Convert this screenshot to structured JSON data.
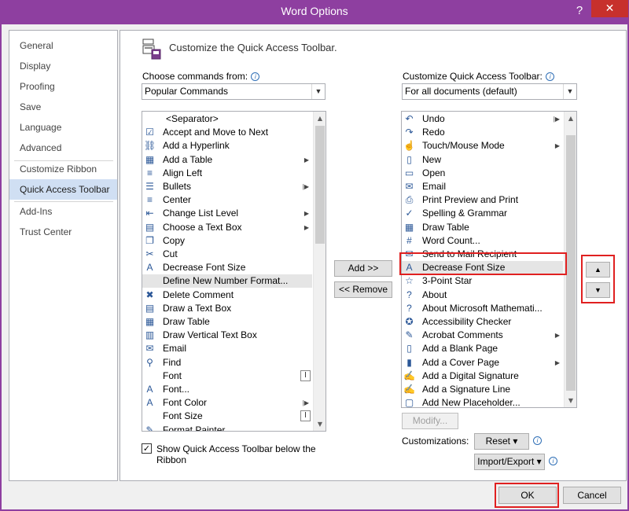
{
  "window": {
    "title": "Word Options",
    "help_label": "?",
    "close_label": "✕"
  },
  "nav": {
    "items": [
      {
        "label": "General"
      },
      {
        "label": "Display"
      },
      {
        "label": "Proofing"
      },
      {
        "label": "Save"
      },
      {
        "label": "Language"
      },
      {
        "label": "Advanced"
      },
      {
        "label": "Customize Ribbon"
      },
      {
        "label": "Quick Access Toolbar",
        "selected": true
      },
      {
        "label": "Add-Ins"
      },
      {
        "label": "Trust Center"
      }
    ]
  },
  "panel": {
    "heading": "Customize the Quick Access Toolbar.",
    "choose_label": "Choose commands from:",
    "choose_value": "Popular Commands",
    "customize_label": "Customize Quick Access Toolbar:",
    "customize_value": "For all documents (default)",
    "info_icon": "i"
  },
  "left_list": [
    {
      "icon": "",
      "label": "<Separator>"
    },
    {
      "icon": "check-table-icon",
      "label": "Accept and Move to Next"
    },
    {
      "icon": "hyperlink-icon",
      "label": "Add a Hyperlink"
    },
    {
      "icon": "table-icon",
      "label": "Add a Table",
      "submenu": true
    },
    {
      "icon": "align-left-icon",
      "label": "Align Left"
    },
    {
      "icon": "bullets-icon",
      "label": "Bullets",
      "split": true
    },
    {
      "icon": "center-icon",
      "label": "Center"
    },
    {
      "icon": "list-level-icon",
      "label": "Change List Level",
      "submenu": true
    },
    {
      "icon": "textbox-icon",
      "label": "Choose a Text Box",
      "submenu": true
    },
    {
      "icon": "copy-icon",
      "label": "Copy"
    },
    {
      "icon": "cut-icon",
      "label": "Cut"
    },
    {
      "icon": "font-size-decrease-icon",
      "label": "Decrease Font Size"
    },
    {
      "icon": "",
      "label": "Define New Number Format...",
      "highlight": true
    },
    {
      "icon": "delete-comment-icon",
      "label": "Delete Comment"
    },
    {
      "icon": "draw-textbox-icon",
      "label": "Draw a Text Box"
    },
    {
      "icon": "draw-table-icon",
      "label": "Draw Table"
    },
    {
      "icon": "vertical-textbox-icon",
      "label": "Draw Vertical Text Box"
    },
    {
      "icon": "email-icon",
      "label": "Email"
    },
    {
      "icon": "find-icon",
      "label": "Find"
    },
    {
      "icon": "",
      "label": "Font",
      "fontbox": true
    },
    {
      "icon": "font-dialog-icon",
      "label": "Font..."
    },
    {
      "icon": "font-color-icon",
      "label": "Font Color",
      "split": true
    },
    {
      "icon": "",
      "label": "Font Size",
      "fontbox": true
    },
    {
      "icon": "format-painter-icon",
      "label": "Format Painter"
    }
  ],
  "right_list": [
    {
      "icon": "undo-icon",
      "label": "Undo",
      "split": true
    },
    {
      "icon": "redo-icon",
      "label": "Redo"
    },
    {
      "icon": "touch-mode-icon",
      "label": "Touch/Mouse Mode",
      "submenu": true
    },
    {
      "icon": "new-document-icon",
      "label": "New"
    },
    {
      "icon": "open-folder-icon",
      "label": "Open"
    },
    {
      "icon": "email-icon",
      "label": "Email"
    },
    {
      "icon": "print-preview-icon",
      "label": "Print Preview and Print"
    },
    {
      "icon": "spelling-icon",
      "label": "Spelling & Grammar"
    },
    {
      "icon": "draw-table-icon",
      "label": "Draw Table"
    },
    {
      "icon": "word-count-icon",
      "label": "Word Count..."
    },
    {
      "icon": "send-mail-icon",
      "label": "Send to Mail Recipient"
    },
    {
      "icon": "font-size-decrease-icon",
      "label": "Decrease Font Size",
      "highlight": true
    },
    {
      "icon": "star-icon",
      "label": "3-Point Star"
    },
    {
      "icon": "about-icon",
      "label": "About"
    },
    {
      "icon": "about-math-icon",
      "label": "About Microsoft Mathemati..."
    },
    {
      "icon": "accessibility-icon",
      "label": "Accessibility Checker"
    },
    {
      "icon": "acrobat-comments-icon",
      "label": "Acrobat Comments",
      "submenu": true
    },
    {
      "icon": "blank-page-icon",
      "label": "Add a Blank Page"
    },
    {
      "icon": "cover-page-icon",
      "label": "Add a Cover Page",
      "submenu": true
    },
    {
      "icon": "digital-signature-icon",
      "label": "Add a Digital Signature"
    },
    {
      "icon": "signature-line-icon",
      "label": "Add a Signature Line"
    },
    {
      "icon": "placeholder-icon",
      "label": "Add New Placeholder..."
    }
  ],
  "buttons": {
    "add": "Add >>",
    "remove": "<< Remove",
    "modify": "Modify...",
    "customizations_label": "Customizations:",
    "reset": "Reset ▾",
    "import_export": "Import/Export ▾",
    "ok": "OK",
    "cancel": "Cancel",
    "move_up": "▲",
    "move_down": "▼"
  },
  "checkbox": {
    "label_line1": "Show Quick Access Toolbar below the",
    "label_line2": "Ribbon",
    "checked": true
  },
  "colors": {
    "title_bar": "#8e3fa0",
    "close_button": "#c7302c",
    "selected_nav": "#d0dff3",
    "highlight_box": "#e02020"
  }
}
